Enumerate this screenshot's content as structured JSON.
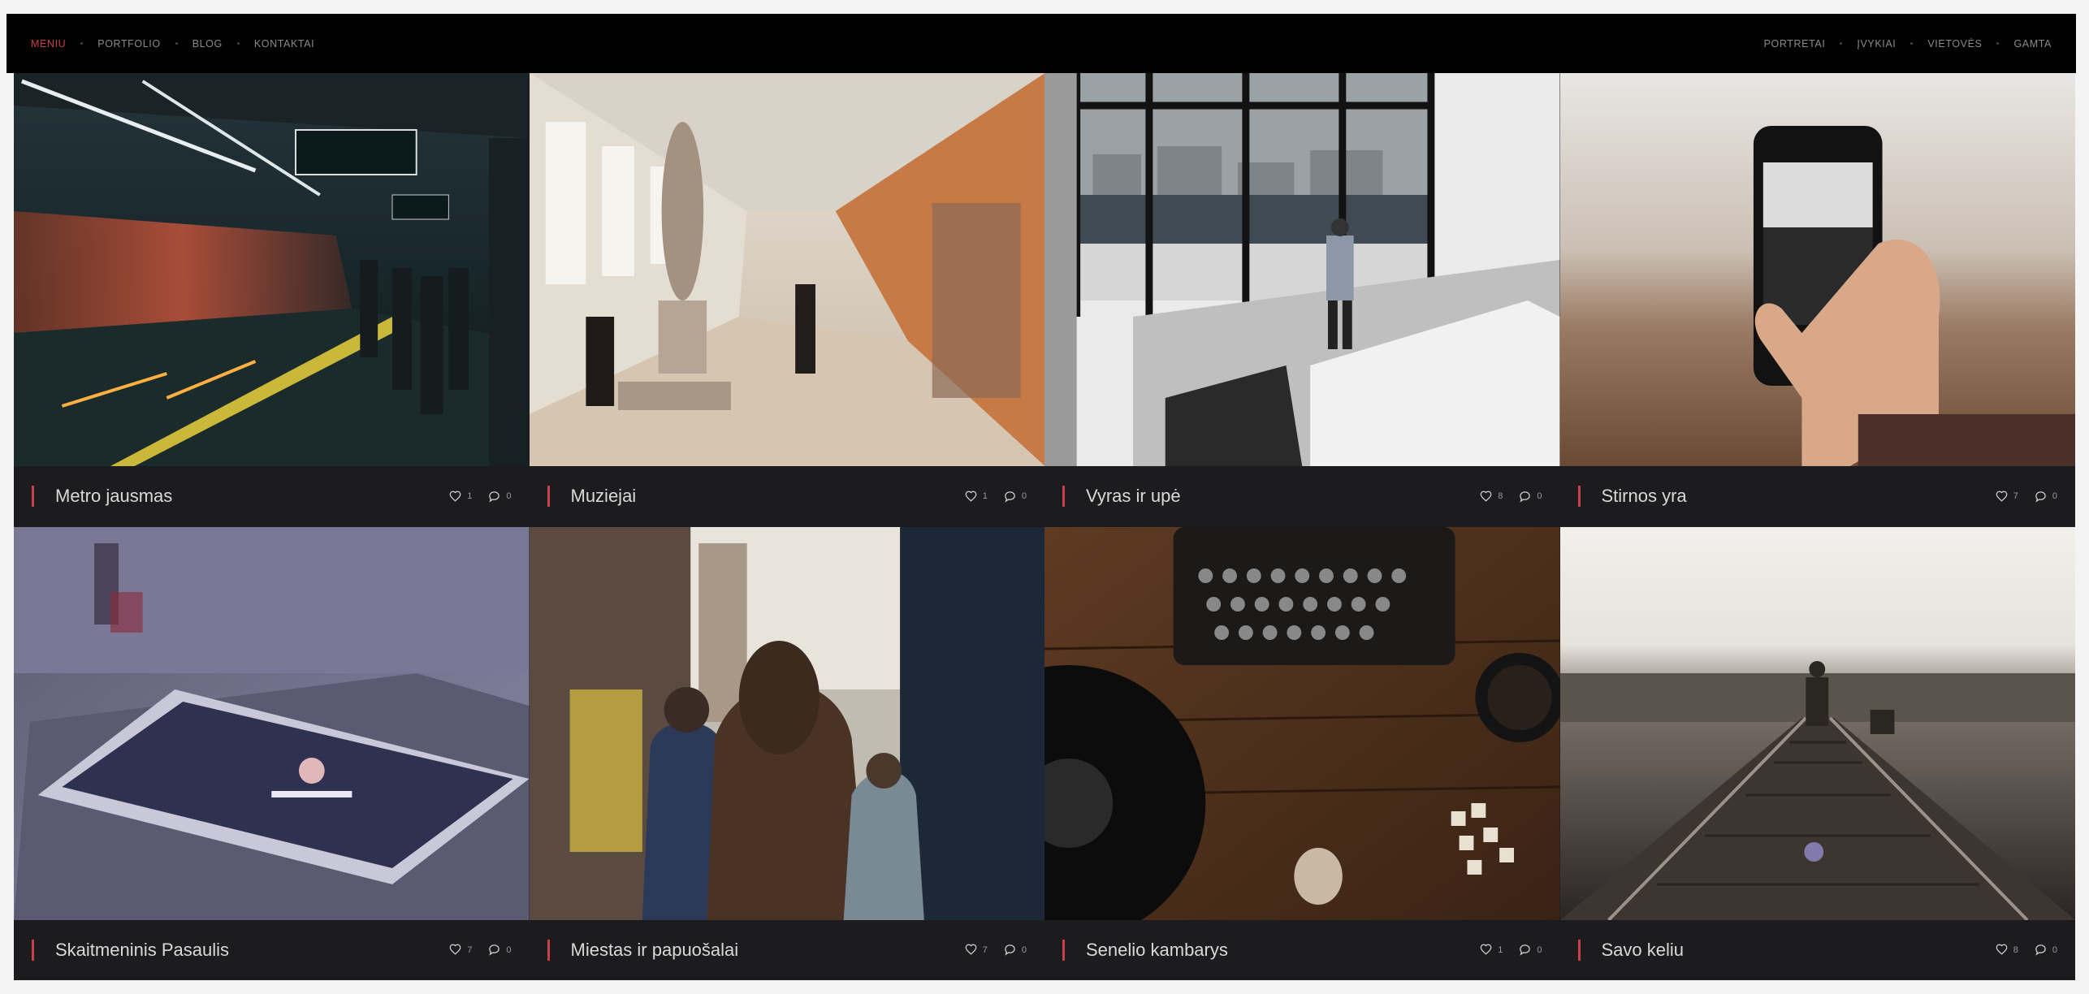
{
  "nav_left": [
    {
      "label": "MENIU",
      "active": true
    },
    {
      "label": "PORTFOLIO",
      "active": false
    },
    {
      "label": "BLOG",
      "active": false
    },
    {
      "label": "KONTAKTAI",
      "active": false
    }
  ],
  "nav_right": [
    {
      "label": "PORTRETAI"
    },
    {
      "label": "ĮVYKIAI"
    },
    {
      "label": "VIETOVĖS"
    },
    {
      "label": "GAMTA"
    }
  ],
  "colors": {
    "accent": "#c8404b",
    "topbar": "#000000",
    "caption": "#1c1c1f"
  },
  "icons": {
    "likes": "heart-icon",
    "comments": "comment-icon"
  },
  "posts": [
    {
      "title": "Metro jausmas",
      "likes": "1",
      "comments": "0",
      "scene": "subway"
    },
    {
      "title": "Muziejai",
      "likes": "1",
      "comments": "0",
      "scene": "museum"
    },
    {
      "title": "Vyras ir upė",
      "likes": "8",
      "comments": "0",
      "scene": "window"
    },
    {
      "title": "Stirnos yra",
      "likes": "7",
      "comments": "0",
      "scene": "phone"
    },
    {
      "title": "Skaitmeninis Pasaulis",
      "likes": "7",
      "comments": "0",
      "scene": "tablet"
    },
    {
      "title": "Miestas ir papuošalai",
      "likes": "7",
      "comments": "0",
      "scene": "street"
    },
    {
      "title": "Senelio kambarys",
      "likes": "1",
      "comments": "0",
      "scene": "desk"
    },
    {
      "title": "Savo keliu",
      "likes": "8",
      "comments": "0",
      "scene": "tracks"
    }
  ]
}
